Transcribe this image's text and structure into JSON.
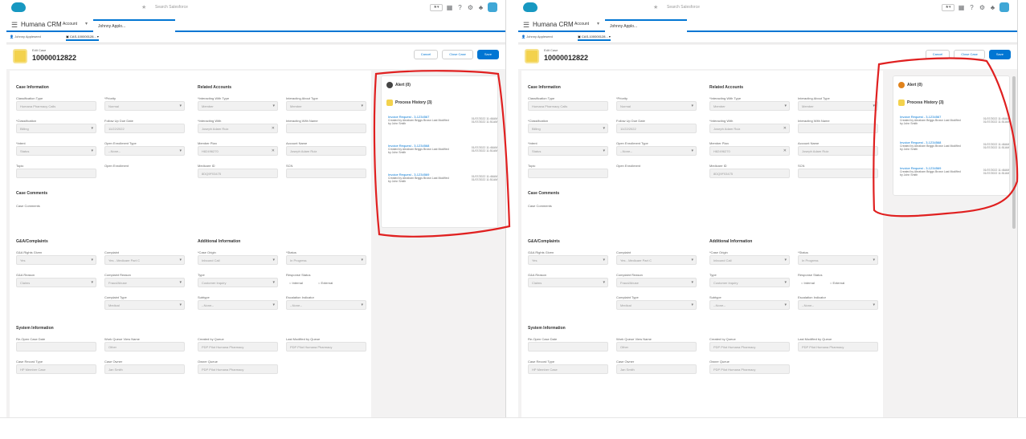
{
  "shell": {
    "app_name": "Humana CRM",
    "nav_account": "Account",
    "nav_tab": "Johnny Applo...",
    "search_placeholder": "Search Salesforce",
    "subtab_1": "Johnny Appleseed",
    "subtab_2": "CAS-100000128..."
  },
  "header": {
    "edit_label": "Edit Case",
    "case_number": "10000012822",
    "cancel_label": "Cancel",
    "close_label": "Close Case",
    "save_label": "Save"
  },
  "case_info": {
    "title": "Case Information",
    "fields": [
      {
        "label": "Classification Type",
        "value": "Humana Pharmacy Calls"
      },
      {
        "label": "*Priority",
        "value": "Normal"
      },
      {
        "label": "*Classification",
        "value": "Billing"
      },
      {
        "label": "Follow Up Due Date",
        "value": "11/22/2022"
      },
      {
        "label": "*Intent",
        "value": "Status"
      },
      {
        "label": "Open Enrollment Type",
        "value": "--None--"
      },
      {
        "label": "Topic",
        "value": ""
      },
      {
        "label": "Open Enrollment",
        "value": ""
      }
    ]
  },
  "related": {
    "title": "Related Accounts",
    "fields": [
      {
        "label": "*Interacting With Type",
        "value": "Member"
      },
      {
        "label": "Interacting About Type",
        "value": "Member"
      },
      {
        "label": "*Interacting With",
        "value": "Joseph Adam Ruiz"
      },
      {
        "label": "Interacting With Name",
        "value": ""
      },
      {
        "label": "Member Plan",
        "value": "H82496270"
      },
      {
        "label": "Account Name",
        "value": "Joseph Adam Ruiz"
      },
      {
        "label": "Medicare ID",
        "value": "8DQ9F03475"
      },
      {
        "label": "SCN",
        "value": ""
      }
    ]
  },
  "comments": {
    "title": "Case Comments",
    "label": "Case Comments"
  },
  "ga": {
    "title": "G&A/Complaints",
    "fields": [
      {
        "label": "G&A Rights Given",
        "value": "Yes"
      },
      {
        "label": "Complaint",
        "value": "Yes - Medicare Part C"
      },
      {
        "label": "G&A Reason",
        "value": "Claims"
      },
      {
        "label": "Complaint Reason",
        "value": "Fraud/Abuse"
      },
      {
        "label": "Complaint Type",
        "value": "Medical"
      }
    ]
  },
  "additional": {
    "title": "Additional Information",
    "fields": [
      {
        "label": "*Case Origin",
        "value": "Inbound Call"
      },
      {
        "label": "*Status",
        "value": "In Progress"
      },
      {
        "label": "Type",
        "value": "Customer Inquiry"
      },
      {
        "label": "Response Status",
        "value": ""
      },
      {
        "label": "Subtype",
        "value": "--None--"
      },
      {
        "label": "Escalation Indicator",
        "value": "--None--"
      }
    ],
    "radio_internal": "Internal",
    "radio_external": "External"
  },
  "system": {
    "title": "System Information",
    "fields": [
      {
        "label": "Re-Open Case Date",
        "value": ""
      },
      {
        "label": "Work Queue View Name",
        "value": "Other"
      },
      {
        "label": "Created by Queue",
        "value": "PDP Pilot Humana Pharmacy"
      },
      {
        "label": "Last Modified by Queue",
        "value": "PDP Pilot Humana Pharmacy"
      },
      {
        "label": "Case Record Type",
        "value": "HP Member Case"
      },
      {
        "label": "Case Owner",
        "value": "Jan Smith"
      },
      {
        "label": "Owner Queue",
        "value": "PDP Pilot Humana Pharmacy"
      }
    ]
  },
  "sidebar": {
    "alerts_title": "Alert (0)",
    "ph_title": "Process History (3)",
    "items": [
      {
        "link": "Invoice Request - 3-1234567",
        "desc": "Created by Abraham Briggs Brown Last Modified by John Smith",
        "time1": "01/07/2022 11:46AM",
        "time2": "01/07/2022 11:51AM"
      },
      {
        "link": "Invoice Request - 3-1234568",
        "desc": "Created by Abraham Briggs Brown Last Modified by John Smith",
        "time1": "01/07/2022 11:46AM",
        "time2": "01/07/2022 11:51AM"
      },
      {
        "link": "Invoice Request - 3-1234569",
        "desc": "Created by Abraham Briggs Brown Last Modified by John Smith",
        "time1": "01/07/2022 11:46AM",
        "time2": "01/07/2022 11:51AM"
      }
    ]
  },
  "colors": {
    "brand_blue": "#0176d3",
    "annotation_red": "#e02020",
    "case_icon": "#f3d24d"
  }
}
